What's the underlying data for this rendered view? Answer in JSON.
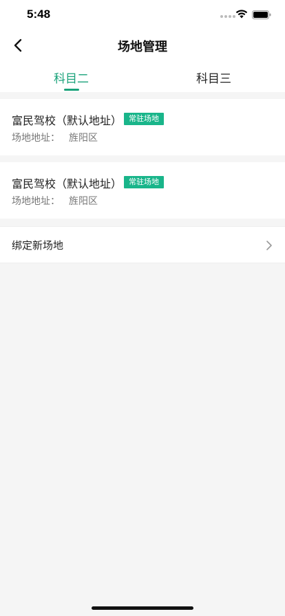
{
  "status_bar": {
    "time": "5:48"
  },
  "nav": {
    "title": "场地管理",
    "back_icon": "chevron-left-icon"
  },
  "tabs": [
    {
      "label": "科目二",
      "active": true
    },
    {
      "label": "科目三",
      "active": false
    }
  ],
  "venues": [
    {
      "name": "富民驾校（默认地址）",
      "badge": "常驻场地",
      "address_label": "场地地址：",
      "address": "旌阳区"
    },
    {
      "name": "富民驾校（默认地址）",
      "badge": "常驻场地",
      "address_label": "场地地址：",
      "address": "旌阳区"
    }
  ],
  "bind_new": {
    "label": "绑定新场地",
    "icon": "chevron-right-icon"
  },
  "colors": {
    "accent": "#19a27a",
    "badge": "#19b58a",
    "background": "#f5f5f5"
  }
}
